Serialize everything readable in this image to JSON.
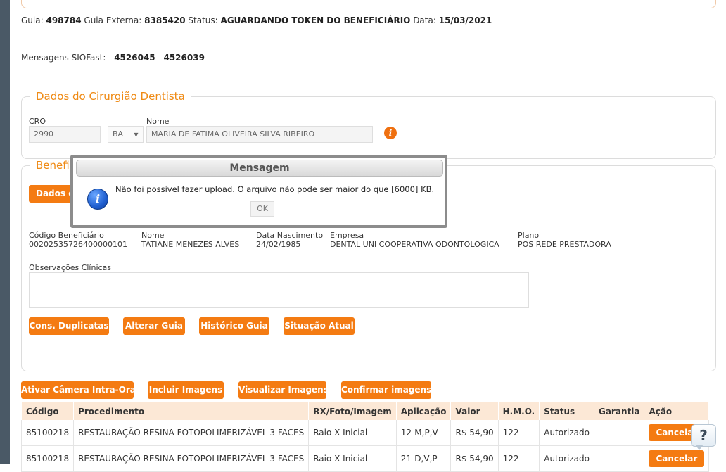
{
  "header": {
    "guia_label": "Guia:",
    "guia_value": "498784",
    "guia_externa_label": "Guia Externa:",
    "guia_externa_value": "8385420",
    "status_label": "Status:",
    "status_value": "AGUARDANDO TOKEN DO BENEFICIÁRIO",
    "data_label": "Data:",
    "data_value": "15/03/2021",
    "mensagens_label": "Mensagens SIOFast:",
    "mensagens": [
      "4526045",
      "4526039"
    ]
  },
  "dentista": {
    "legend": "Dados do Cirurgião Dentista",
    "cro_label": "CRO",
    "cro_value": "2990",
    "uf_value": "BA",
    "nome_label": "Nome",
    "nome_value": "MARIA DE FATIMA OLIVEIRA SILVA RIBEIRO",
    "info_icon": "i"
  },
  "beneficiario": {
    "legend_visible": "Benefic",
    "dados_button_visible": "Dados do",
    "codigo_label": "Código Beneficiário",
    "codigo_value": "00202535726400000101",
    "nome_label": "Nome",
    "nome_value": "TATIANE MENEZES ALVES",
    "nascimento_label": "Data Nascimento",
    "nascimento_value": "24/02/1985",
    "empresa_label": "Empresa",
    "empresa_value": "DENTAL UNI COOPERATIVA ODONTOLOGICA",
    "plano_label": "Plano",
    "plano_value": "POS REDE PRESTADORA",
    "obs_label": "Observações Clínicas",
    "buttons": [
      "Cons. Duplicatas",
      "Alterar Guia",
      "Histórico Guia",
      "Situação Atual"
    ]
  },
  "image_buttons": [
    "Ativar Câmera Intra-Oral",
    "Incluir Imagens",
    "Visualizar Imagens",
    "Confirmar imagens"
  ],
  "table": {
    "headers": [
      "Código",
      "Procedimento",
      "RX/Foto/Imagem",
      "Aplicação",
      "Valor",
      "H.M.O.",
      "Status",
      "Garantia",
      "Ação"
    ],
    "rows": [
      [
        "85100218",
        "RESTAURAÇÃO RESINA FOTOPOLIMERIZÁVEL 3 FACES",
        "Raio X Inicial",
        "12-M,P,V",
        "R$ 54,90",
        "122",
        "Autorizado",
        "",
        "Cancelar"
      ],
      [
        "85100218",
        "RESTAURAÇÃO RESINA FOTOPOLIMERIZÁVEL 3 FACES",
        "Raio X Inicial",
        "21-D,V,P",
        "R$ 54,90",
        "122",
        "Autorizado",
        "",
        "Cancelar"
      ]
    ]
  },
  "modal": {
    "title": "Mensagem",
    "text": "Não foi possível fazer upload. O arquivo não pode ser maior do que [6000] KB.",
    "ok_label": "OK",
    "icon": "i"
  },
  "help": {
    "label": "?"
  },
  "colors": {
    "accent": "#f47b12",
    "legend": "#ef8a14",
    "table_header": "#fce8d6",
    "sidebar": "#4a5966"
  }
}
